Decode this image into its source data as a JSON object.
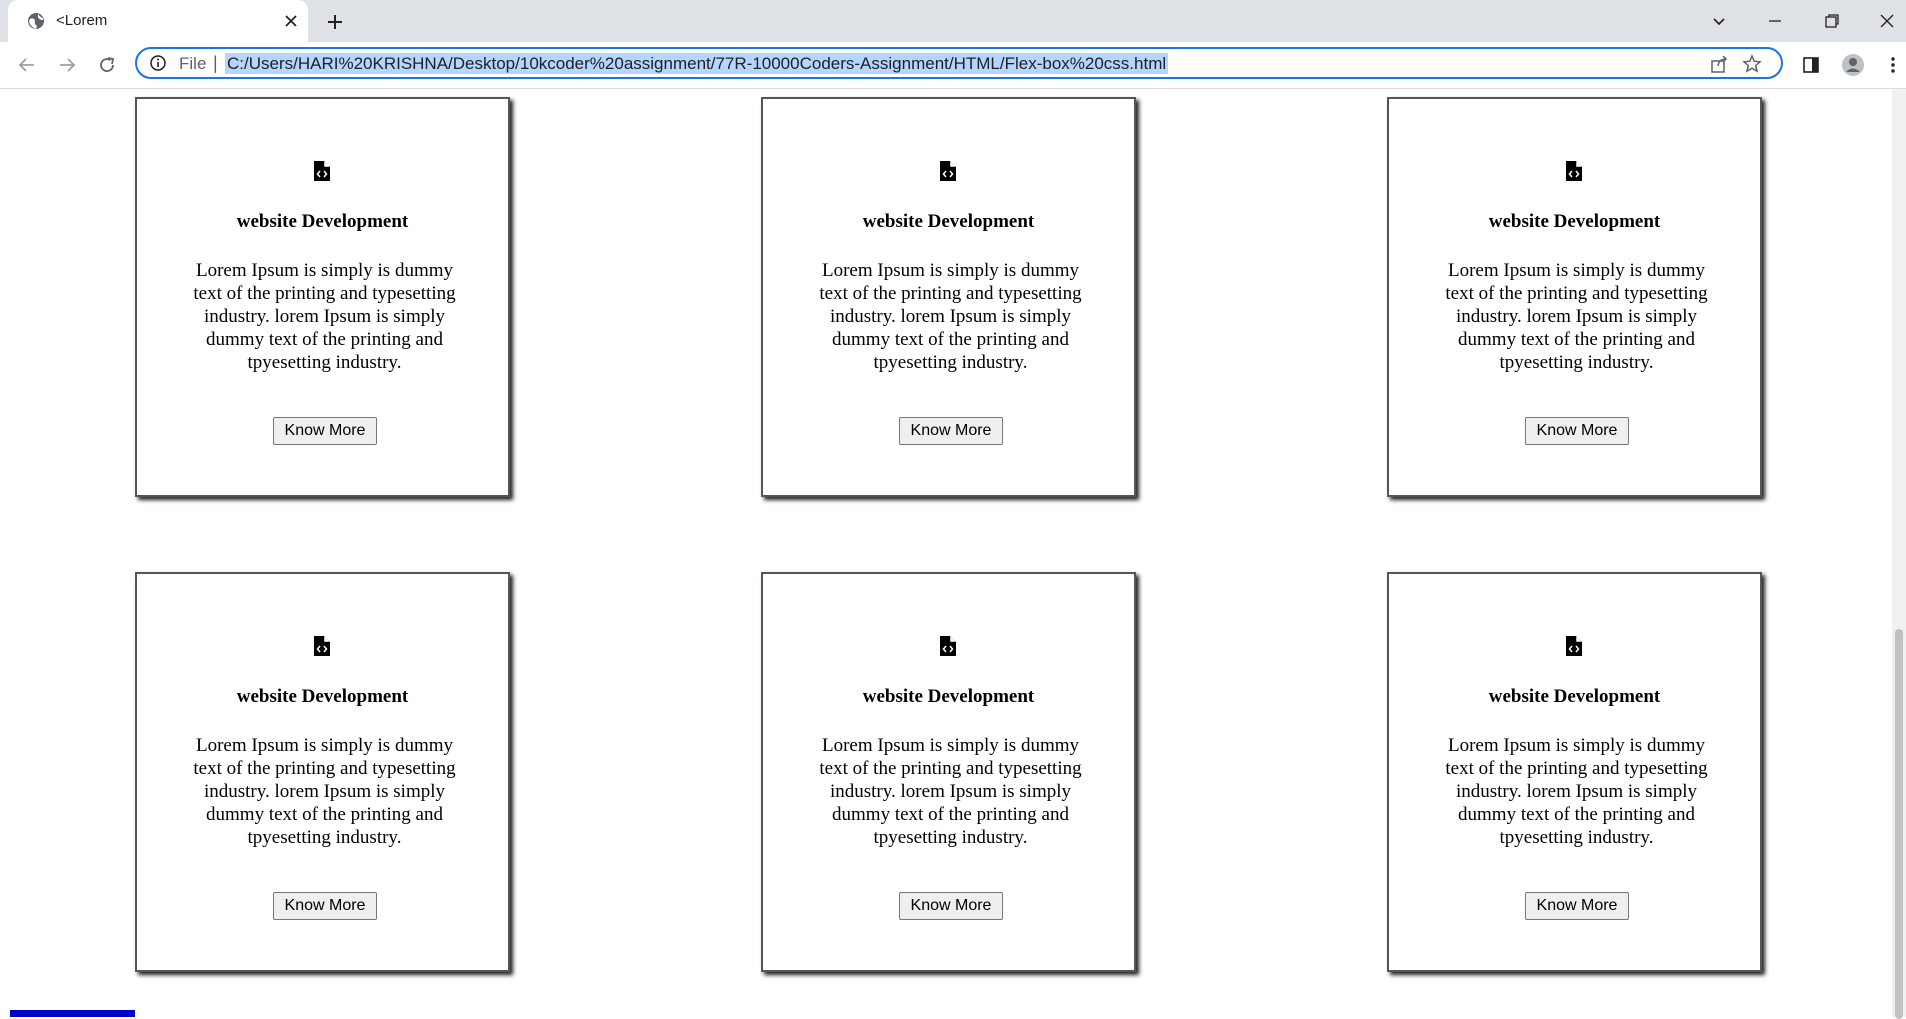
{
  "browser": {
    "tab_title": "<Lorem",
    "omnibox_prefix": "File",
    "url": "C:/Users/HARI%20KRISHNA/Desktop/10kcoder%20assignment/77R-10000Coders-Assignment/HTML/Flex-box%20css.html"
  },
  "cards": [
    {
      "title": "website Development",
      "text": "Lorem Ipsum is simply is dummy text of the printing and typesetting industry. lorem Ipsum is simply dummy text of the printing and tpyesetting industry.",
      "button": "Know More"
    },
    {
      "title": "website Development",
      "text": "Lorem Ipsum is simply is dummy text of the printing and typesetting industry. lorem Ipsum is simply dummy text of the printing and tpyesetting industry.",
      "button": "Know More"
    },
    {
      "title": "website Development",
      "text": "Lorem Ipsum is simply is dummy text of the printing and typesetting industry. lorem Ipsum is simply dummy text of the printing and tpyesetting industry.",
      "button": "Know More"
    },
    {
      "title": "website Development",
      "text": "Lorem Ipsum is simply is dummy text of the printing and typesetting industry. lorem Ipsum is simply dummy text of the printing and tpyesetting industry.",
      "button": "Know More"
    },
    {
      "title": "website Development",
      "text": "Lorem Ipsum is simply is dummy text of the printing and typesetting industry. lorem Ipsum is simply dummy text of the printing and tpyesetting industry.",
      "button": "Know More"
    },
    {
      "title": "website Development",
      "text": "Lorem Ipsum is simply is dummy text of the printing and typesetting industry. lorem Ipsum is simply dummy text of the printing and tpyesetting industry.",
      "button": "Know More"
    }
  ],
  "icons": {
    "card_icon": "file-code-icon"
  },
  "colors": {
    "omnibox_border": "#1a73e8",
    "url_highlight": "#b4d5fe",
    "footer_bar": "#0000cc"
  }
}
